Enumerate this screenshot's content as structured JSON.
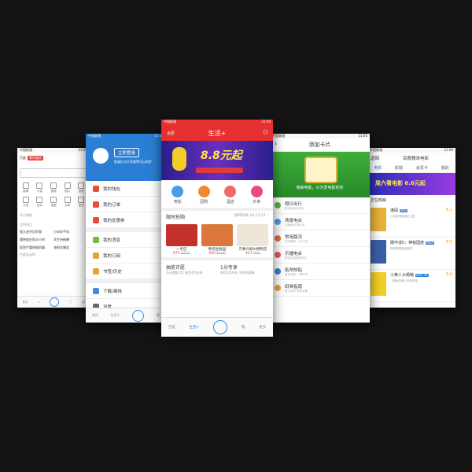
{
  "status": {
    "carrier": "中国联通",
    "time": "21:00"
  },
  "s1": {
    "header_prefix": "百度",
    "header_tag": "猜你喜欢",
    "grid": [
      "新闻",
      "小说",
      "视频",
      "图片",
      "贴吧",
      "小说",
      "百科",
      "地图",
      "文库",
      "更多"
    ],
    "section": "今日热搜",
    "hot_title": "实时热点",
    "hot": [
      "强大进京后的我",
      "小伙伴手机",
      "遭殃就在脸半小时",
      "学生持械暴",
      "医院严重网络机器",
      "张柏芝婚恋"
    ],
    "hot_more": "百度风云榜",
    "tabs": [
      "首页",
      "",
      "",
      "",
      "我"
    ]
  },
  "s2": {
    "login": "立即登录",
    "sub": "登录后卡片导航等可以同步",
    "items": [
      {
        "label": "我的钱包",
        "color": "#e64b3b"
      },
      {
        "label": "我的订单",
        "color": "#e64b3b"
      },
      {
        "label": "我的优惠券",
        "color": "#e64b3b"
      },
      {
        "label": "我的消息",
        "color": "#6bbf3a"
      },
      {
        "label": "我的订阅",
        "color": "#e6a13b"
      },
      {
        "label": "书签/历史",
        "color": "#e6a13b"
      },
      {
        "label": "下载/离线",
        "color": "#3b8de0"
      },
      {
        "label": "设置",
        "color": "#666666"
      }
    ],
    "tabs": [
      "首页",
      "生活+",
      "我"
    ]
  },
  "s3": {
    "city": "太原",
    "title": "生活+",
    "banner": "8.8元起",
    "categories": [
      {
        "label": "电影",
        "color": "#4a9be8"
      },
      {
        "label": "团购",
        "color": "#f08a2a"
      },
      {
        "label": "酒店",
        "color": "#f06a6a"
      },
      {
        "label": "外卖",
        "color": "#e84a8a"
      }
    ],
    "flash_title": "限时抢购",
    "flash_next": "即将开始",
    "flash_time": "10:13:57",
    "deals": [
      {
        "name": "一手店",
        "price": "¥75",
        "old": "¥100",
        "color": "#c4302b"
      },
      {
        "name": "养鸽生鲜园",
        "price": "¥85",
        "old": "¥100",
        "color": "#d9783a"
      },
      {
        "name": "万事兴郑州烤鸭店",
        "price": "¥27",
        "old": "¥54",
        "color": "#ede6d8"
      }
    ],
    "lottery_title": "抽奖许愿",
    "lottery_sub": "1元就够大奖 抽奖4月在线",
    "exclusive_title": "1分专享",
    "exclusive_sub": "电信1000毛 手机充赛事",
    "tabs": [
      "百度",
      "生活+",
      "",
      "我",
      "更多"
    ]
  },
  "s4": {
    "title": "添加卡片",
    "banner": "热映电影，只为爱电影的你",
    "items": [
      {
        "label": "假日出行",
        "sub": "附近游玩好去处",
        "color": "#5ab04a"
      },
      {
        "label": "场景电台",
        "sub": "场景音乐 随心听",
        "color": "#4a9be8"
      },
      {
        "label": "常用路况",
        "sub": "实时路况 一目了然",
        "color": "#e06a3a"
      },
      {
        "label": "乐播电台",
        "sub": "精选优质音频节目",
        "color": "#e05a5a"
      },
      {
        "label": "贴吧热贴",
        "sub": "每日热贴 一网打尽",
        "color": "#3b7fd8"
      },
      {
        "label": "妈咪指南",
        "sub": "育儿知识 妈咪必备",
        "color": "#e6a13b"
      }
    ]
  },
  "s5": {
    "back": "返回",
    "title": "百度糯米电影",
    "tabs": [
      "电影",
      "影院",
      "会员卡",
      "我的"
    ],
    "banner": "周六看电影 6.6元起",
    "section": "正在热映",
    "films": [
      {
        "title": "港囧",
        "tag": "IMAX",
        "score": "8.2",
        "sub": "人在香港的回忆之旅",
        "color": "#e9b13a"
      },
      {
        "title": "碟中谍5：神秘国度",
        "tag": "IMAX",
        "score": "8.5",
        "sub": "阿汤哥再挑战极限",
        "color": "#3a5fa8"
      },
      {
        "title": "小黄人大眼萌",
        "tag": "IMAX 3D",
        "score": "8.6",
        "sub": "《神偷奶爸》系列前传",
        "color": "#f2cf28"
      }
    ]
  }
}
